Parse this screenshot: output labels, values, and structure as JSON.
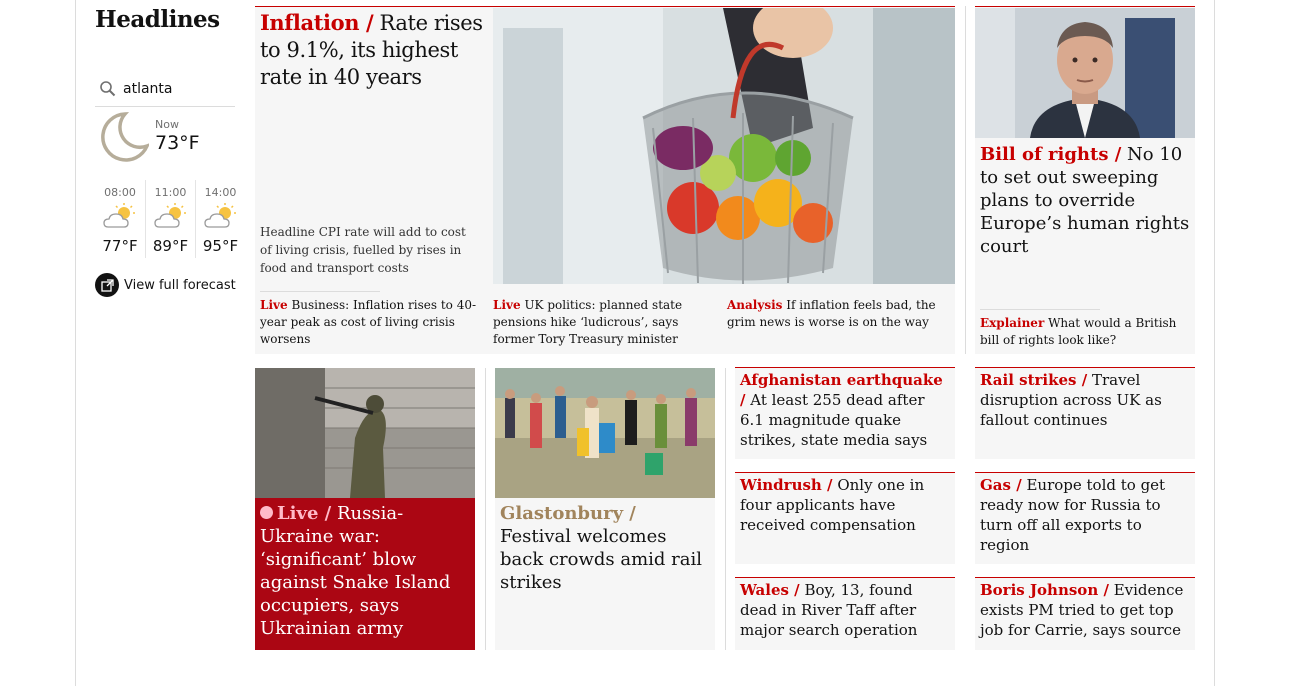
{
  "section": {
    "title": "Headlines"
  },
  "weather": {
    "location": "atlanta",
    "now_label": "Now",
    "now_temp": "73°F",
    "forecast": [
      {
        "time": "08:00",
        "temp": "77°F",
        "icon": "partly-sunny-icon"
      },
      {
        "time": "11:00",
        "temp": "89°F",
        "icon": "partly-sunny-icon"
      },
      {
        "time": "14:00",
        "temp": "95°F",
        "icon": "partly-sunny-icon"
      }
    ],
    "view_full_forecast": "View full forecast"
  },
  "lead": {
    "kicker": "Inflation /",
    "headline": "Rate rises to 9.1%, its highest rate in 40 years",
    "standfirst": "Headline CPI rate will add to cost of living crisis, fuelled by rises in food and transport costs",
    "sublinks": [
      {
        "kicker": "Live",
        "text": "Business: Inflation rises to 40-year peak as cost of living crisis worsens"
      },
      {
        "kicker": "Live",
        "text": "UK politics: planned state pensions hike ‘ludicrous’, says former Tory Treasury minister"
      },
      {
        "kicker": "Analysis",
        "text": "If inflation feels bad, the grim news is worse is on the way"
      }
    ]
  },
  "raab": {
    "kicker": "Bill of rights /",
    "headline": "No 10 to set out sweeping plans to override Europe’s human rights court",
    "sub_kicker": "Explainer",
    "sub_text": "What would a British bill of rights look like?"
  },
  "ukraine": {
    "kicker": "Live /",
    "headline": "Russia-Ukraine war: ‘significant’ blow against Snake Island occupiers, says Ukrainian army"
  },
  "glastonbury": {
    "kicker": "Glastonbury /",
    "headline": "Festival welcomes back crowds amid rail strikes"
  },
  "small_cards": [
    {
      "kicker": "Afghanistan earthquake /",
      "headline": "At least 255 dead after 6.1 magnitude quake strikes, state media says"
    },
    {
      "kicker": "Rail strikes /",
      "headline": "Travel disruption across UK as fallout continues"
    },
    {
      "kicker": "Windrush /",
      "headline": "Only one in four applicants have received compensation"
    },
    {
      "kicker": "Gas /",
      "headline": "Europe told to get ready now for Russia to turn off all exports to region"
    },
    {
      "kicker": "Wales /",
      "headline": "Boy, 13, found dead in River Taff after major search operation"
    },
    {
      "kicker": "Boris Johnson /",
      "headline": "Evidence exists PM tried to get top job for Carrie, says source"
    }
  ],
  "colors": {
    "news_red": "#c70000",
    "live_red": "#ab0613",
    "culture": "#a1845c",
    "card_bg": "#f6f6f6"
  }
}
